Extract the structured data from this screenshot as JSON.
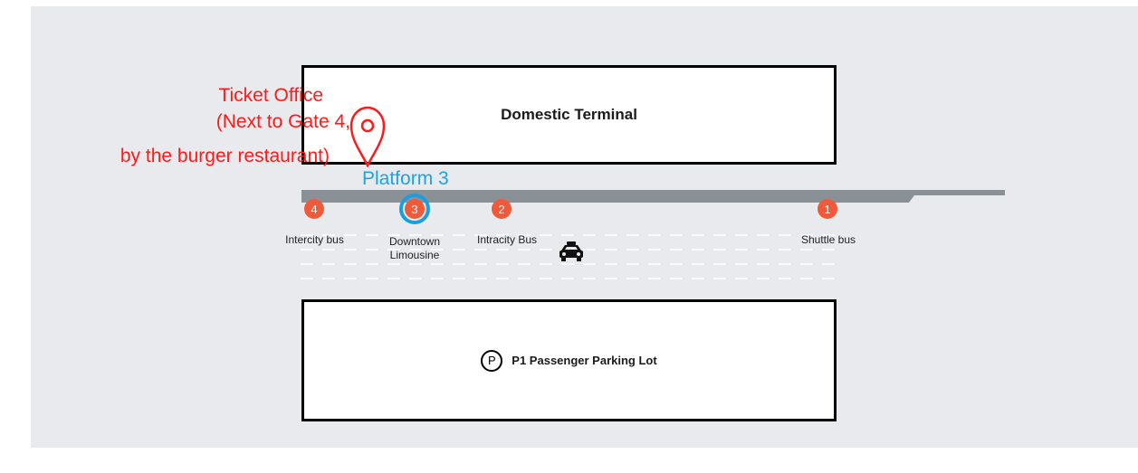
{
  "terminal": {
    "label": "Domestic Terminal"
  },
  "parking": {
    "badge": "P",
    "label": "P1 Passenger Parking Lot"
  },
  "stops": [
    {
      "number": "4",
      "label": "Intercity bus",
      "selected": false
    },
    {
      "number": "3",
      "label": "Downtown\nLimousine",
      "selected": true
    },
    {
      "number": "2",
      "label": "Intracity Bus",
      "selected": false
    },
    {
      "number": "1",
      "label": "Shuttle bus",
      "selected": false
    }
  ],
  "annotations": {
    "ticket_office_title": "Ticket Office",
    "ticket_office_line2": "(Next to Gate 4,",
    "ticket_office_line3": "by the burger restaurant)",
    "platform_label": "Platform 3"
  },
  "icons": {
    "taxi": "taxi-icon",
    "pin": "location-pin-icon"
  },
  "colors": {
    "stop_badge": "#ee5a3a",
    "selected_ring": "#1a9ee0",
    "annotation_red": "#ff1a1a",
    "platform_blue": "#1ba3e8",
    "curb": "#8a9196",
    "map_background": "#e8eaed"
  }
}
